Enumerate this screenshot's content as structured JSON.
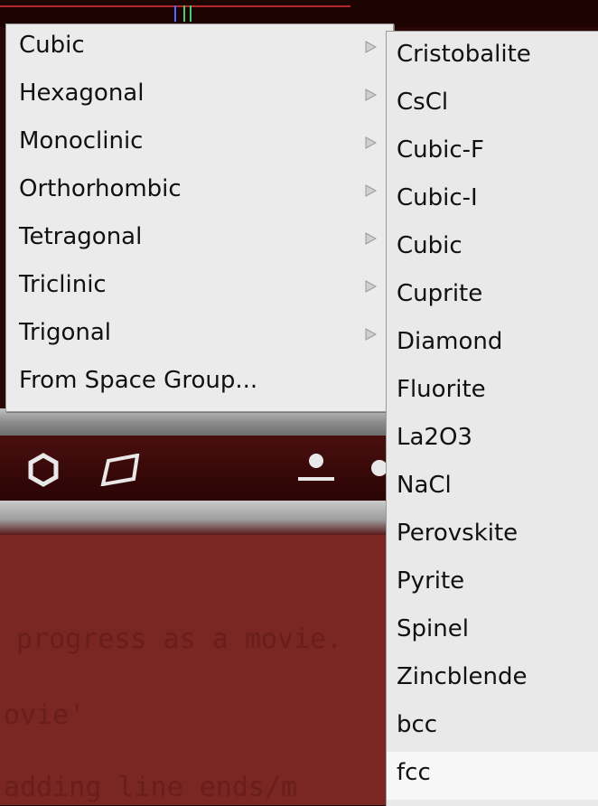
{
  "crystal_menu": {
    "items": [
      {
        "label": "Cubic",
        "has_submenu": true
      },
      {
        "label": "Hexagonal",
        "has_submenu": true
      },
      {
        "label": "Monoclinic",
        "has_submenu": true
      },
      {
        "label": "Orthorhombic",
        "has_submenu": true
      },
      {
        "label": "Tetragonal",
        "has_submenu": true
      },
      {
        "label": "Triclinic",
        "has_submenu": true
      },
      {
        "label": "Trigonal",
        "has_submenu": true
      },
      {
        "label": "From Space Group...",
        "has_submenu": false
      }
    ]
  },
  "cubic_submenu": {
    "items": [
      {
        "label": "Cristobalite"
      },
      {
        "label": "CsCl"
      },
      {
        "label": "Cubic-F"
      },
      {
        "label": "Cubic-I"
      },
      {
        "label": "Cubic"
      },
      {
        "label": "Cuprite"
      },
      {
        "label": "Diamond"
      },
      {
        "label": "Fluorite"
      },
      {
        "label": "La2O3"
      },
      {
        "label": "NaCl"
      },
      {
        "label": "Perovskite"
      },
      {
        "label": "Pyrite"
      },
      {
        "label": "Spinel"
      },
      {
        "label": "Zincblende"
      },
      {
        "label": "bcc"
      },
      {
        "label": "fcc",
        "highlighted": true
      }
    ]
  },
  "toolbar": {
    "icons": [
      "hexagon-icon",
      "plane-icon",
      "person-icon"
    ]
  },
  "background_text": {
    "line1": "progress as a movie.",
    "line2": "ovie'",
    "line3": "adding line ends/m"
  },
  "colors": {
    "menu_bg": "#ebebeb",
    "highlight_bg": "#f7f7f7",
    "app_bg": "#7a2622"
  }
}
